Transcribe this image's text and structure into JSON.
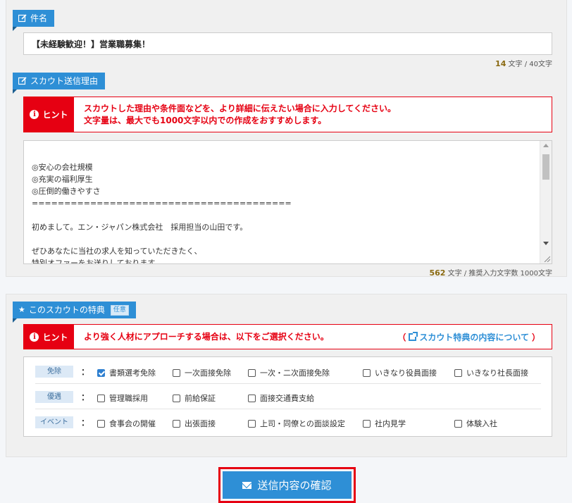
{
  "subject": {
    "tag_label": "件名",
    "tag_icon": "edit-icon",
    "value": "【未経験歓迎！】営業職募集！",
    "counter_count": "14",
    "counter_suffix": "文字 / 40文字"
  },
  "reason": {
    "tag_label": "スカウト送信理由",
    "tag_icon": "edit-icon",
    "hint_label": "ヒント",
    "hint_line1": "スカウトした理由や条件面などを、より詳細に伝えたい場合に入力してください。",
    "hint_line2": "文字量は、最大でも1000文字以内での作成をおすすめします。",
    "body_text": "\n◎安心の会社規模\n◎充実の福利厚生\n◎圧倒的働きやすさ\n========================================\n\n初めまして。エン・ジャパン株式会社　採用担当の山田です。\n\nぜひあなたに当社の求人を知っていただきたく、\n特別オファーをお送りしております。\n今回は「営業職」を募集しています。",
    "counter_count": "562",
    "counter_suffix": "文字 / 推奨入力文字数 1000文字"
  },
  "perks": {
    "tag_label": "このスカウトの特典",
    "tag_icon": "star-icon",
    "tag_badge": "任意",
    "hint_label": "ヒント",
    "hint_text": "より強く人材にアプローチする場合は、以下をご選択ください。",
    "link_open": "（",
    "link_text": "スカウト特典の内容について",
    "link_close": "）",
    "colon": "：",
    "rows": [
      {
        "category": "免除",
        "items": [
          {
            "label": "書類選考免除",
            "checked": true
          },
          {
            "label": "一次面接免除",
            "checked": false
          },
          {
            "label": "一次・二次面接免除",
            "checked": false
          },
          {
            "label": "いきなり役員面接",
            "checked": false
          },
          {
            "label": "いきなり社長面接",
            "checked": false
          }
        ]
      },
      {
        "category": "優遇",
        "items": [
          {
            "label": "管理職採用",
            "checked": false
          },
          {
            "label": "前給保証",
            "checked": false
          },
          {
            "label": "面接交通費支給",
            "checked": false
          }
        ]
      },
      {
        "category": "イベント",
        "items": [
          {
            "label": "食事会の開催",
            "checked": false
          },
          {
            "label": "出張面接",
            "checked": false
          },
          {
            "label": "上司・同僚との面談設定",
            "checked": false
          },
          {
            "label": "社内見学",
            "checked": false
          },
          {
            "label": "体験入社",
            "checked": false
          }
        ]
      }
    ]
  },
  "submit": {
    "label": "送信内容の確認",
    "icon": "mail-icon"
  },
  "colors": {
    "accent": "#2e8fd6",
    "alert": "#e60012",
    "count": "#8a6a12"
  }
}
